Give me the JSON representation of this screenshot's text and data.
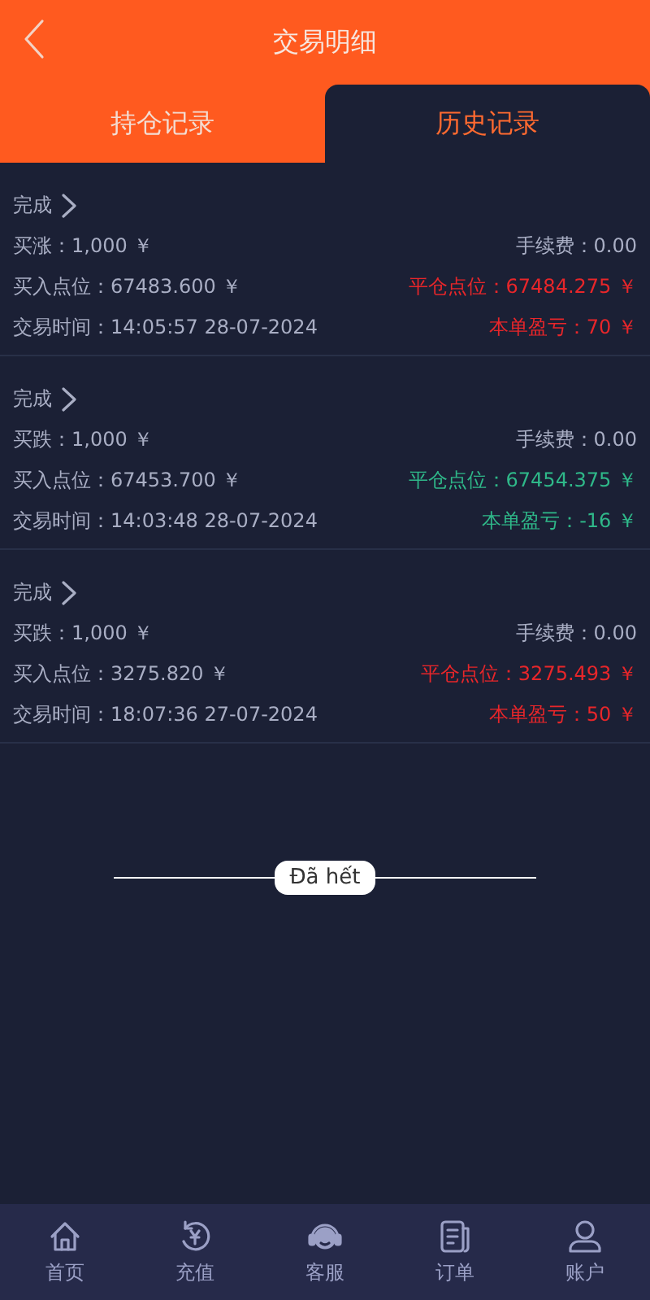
{
  "header": {
    "title": "交易明细"
  },
  "tabs": [
    {
      "label": "持仓记录",
      "selected": false
    },
    {
      "label": "历史记录",
      "selected": true
    }
  ],
  "records": [
    {
      "status": "完成",
      "amount": "买涨：1,000 ￥",
      "fee": "手续费：0.00",
      "open_price": "买入点位：67483.600 ￥",
      "close_price": "平仓点位：67484.275 ￥",
      "time": "交易时间：14:05:57 28-07-2024",
      "profit": "本单盈亏：70 ￥",
      "color": "#e8262a"
    },
    {
      "status": "完成",
      "amount": "买跌：1,000 ￥",
      "fee": "手续费：0.00",
      "open_price": "买入点位：67453.700 ￥",
      "close_price": "平仓点位：67454.375 ￥",
      "time": "交易时间：14:03:48 28-07-2024",
      "profit": "本单盈亏：-16 ￥",
      "color": "#2fb889"
    },
    {
      "status": "完成",
      "amount": "买跌：1,000 ￥",
      "fee": "手续费：0.00",
      "open_price": "买入点位：3275.820 ￥",
      "close_price": "平仓点位：3275.493 ￥",
      "time": "交易时间：18:07:36 27-07-2024",
      "profit": "本单盈亏：50 ￥",
      "color": "#e8262a"
    }
  ],
  "end_marker": "Đã hết",
  "bottom_nav": [
    {
      "label": "首页"
    },
    {
      "label": "充值"
    },
    {
      "label": "客服"
    },
    {
      "label": "订单"
    },
    {
      "label": "账户"
    }
  ]
}
